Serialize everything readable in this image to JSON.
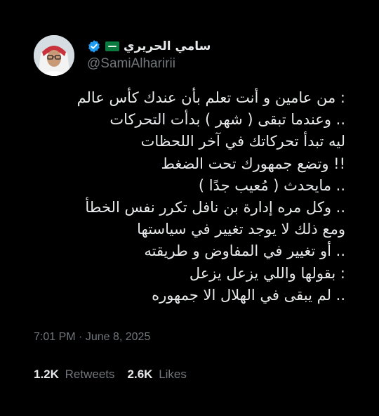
{
  "author": {
    "display_name": "سامي الحريري",
    "handle": "@SamiAlharirii"
  },
  "tweet": {
    "lines": [
      ": من عامين و أنت تعلم بأن عندك كأس عالم",
      ".. وعندما تبقى ( شهر ) بدأت التحركات",
      "ليه تبدأ تحركاتك في آخر اللحظات",
      "!! وتضع جمهورك تحت الضغط",
      ".. مايحدث ( مُعيب جدًا )",
      ".. وكل مره إدارة بن نافل تكرر نفس الخطأ",
      "ومع ذلك لا يوجد تغيير في سياستها",
      ".. أو تغيير في المفاوض و طريقته",
      ": بقولها واللي يزعل يزعل",
      ".. لم يبقى في الهلال الا جمهوره"
    ]
  },
  "meta": {
    "time": "7:01 PM",
    "separator": "·",
    "date": "June 8, 2025"
  },
  "stats": {
    "retweets_count": "1.2K",
    "retweets_label": "Retweets",
    "likes_count": "2.6K",
    "likes_label": "Likes"
  },
  "colors": {
    "background": "#000000",
    "text": "#e7e9ea",
    "secondary": "#71767b",
    "verified_badge": "#1d9bf0"
  }
}
